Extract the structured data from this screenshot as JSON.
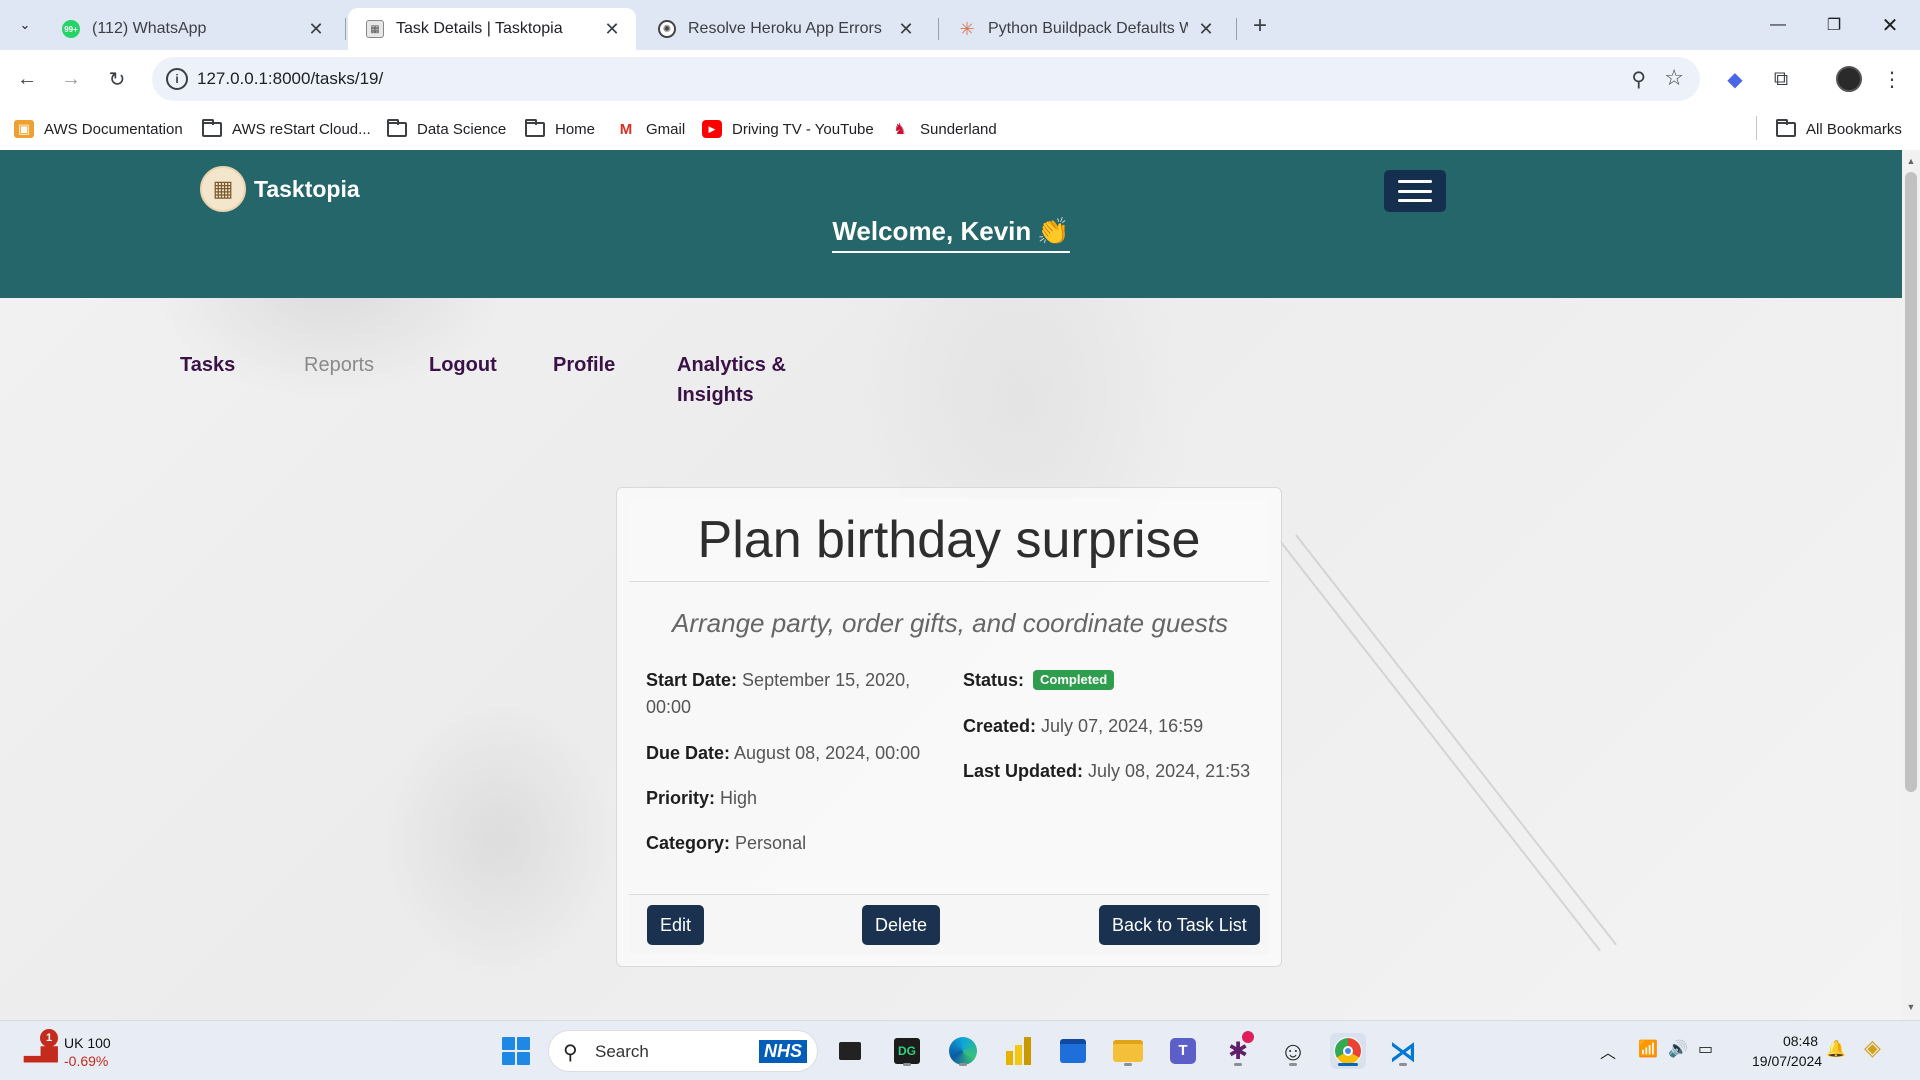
{
  "browser": {
    "tabs": [
      {
        "title": "(112) WhatsApp",
        "favicon": "whatsapp-icon"
      },
      {
        "title": "Task Details | Tasktopia",
        "favicon": "tasktopia-icon"
      },
      {
        "title": "Resolve Heroku App Errors",
        "favicon": "chatgpt-icon"
      },
      {
        "title": "Python Buildpack Defaults WEB",
        "favicon": "claude-icon"
      }
    ],
    "whatsapp_badge": "99+",
    "url": "127.0.0.1:8000/tasks/19/",
    "bookmarks": [
      {
        "label": "AWS Documentation",
        "icon": "aws-icon"
      },
      {
        "label": "AWS reStart Cloud...",
        "icon": "folder-icon"
      },
      {
        "label": "Data Science",
        "icon": "folder-icon"
      },
      {
        "label": "Home",
        "icon": "folder-icon"
      },
      {
        "label": "Gmail",
        "icon": "gmail-icon"
      },
      {
        "label": "Driving TV - YouTube",
        "icon": "youtube-icon"
      },
      {
        "label": "Sunderland",
        "icon": "sunderland-icon"
      }
    ],
    "all_bookmarks": "All Bookmarks"
  },
  "site": {
    "brand": "Tasktopia",
    "welcome": "Welcome, Kevin",
    "welcome_emoji": "👏",
    "nav": [
      "Tasks",
      "Reports",
      "Logout",
      "Profile",
      "Analytics & Insights"
    ],
    "colors": {
      "header": "#25666a",
      "button": "#1a3150",
      "nav_text": "#3b1248",
      "badge": "#2e9e4e"
    }
  },
  "task": {
    "title": "Plan birthday surprise",
    "description": "Arrange party, order gifts, and coordinate guests",
    "start_date_label": "Start Date:",
    "start_date": "September 15, 2020, 00:00",
    "due_date_label": "Due Date:",
    "due_date": "August 08, 2024, 00:00",
    "priority_label": "Priority:",
    "priority": "High",
    "category_label": "Category:",
    "category": "Personal",
    "status_label": "Status:",
    "status": "Completed",
    "created_label": "Created:",
    "created": "July 07, 2024, 16:59",
    "updated_label": "Last Updated:",
    "updated": "July 08, 2024, 21:53"
  },
  "actions": {
    "edit": "Edit",
    "delete": "Delete",
    "back": "Back to Task List"
  },
  "taskbar": {
    "ticker_name": "UK 100",
    "ticker_change": "-0.69%",
    "ticker_badge": "1",
    "search_placeholder": "Search",
    "nhs": "NHS",
    "time": "08:48",
    "date": "19/07/2024"
  }
}
